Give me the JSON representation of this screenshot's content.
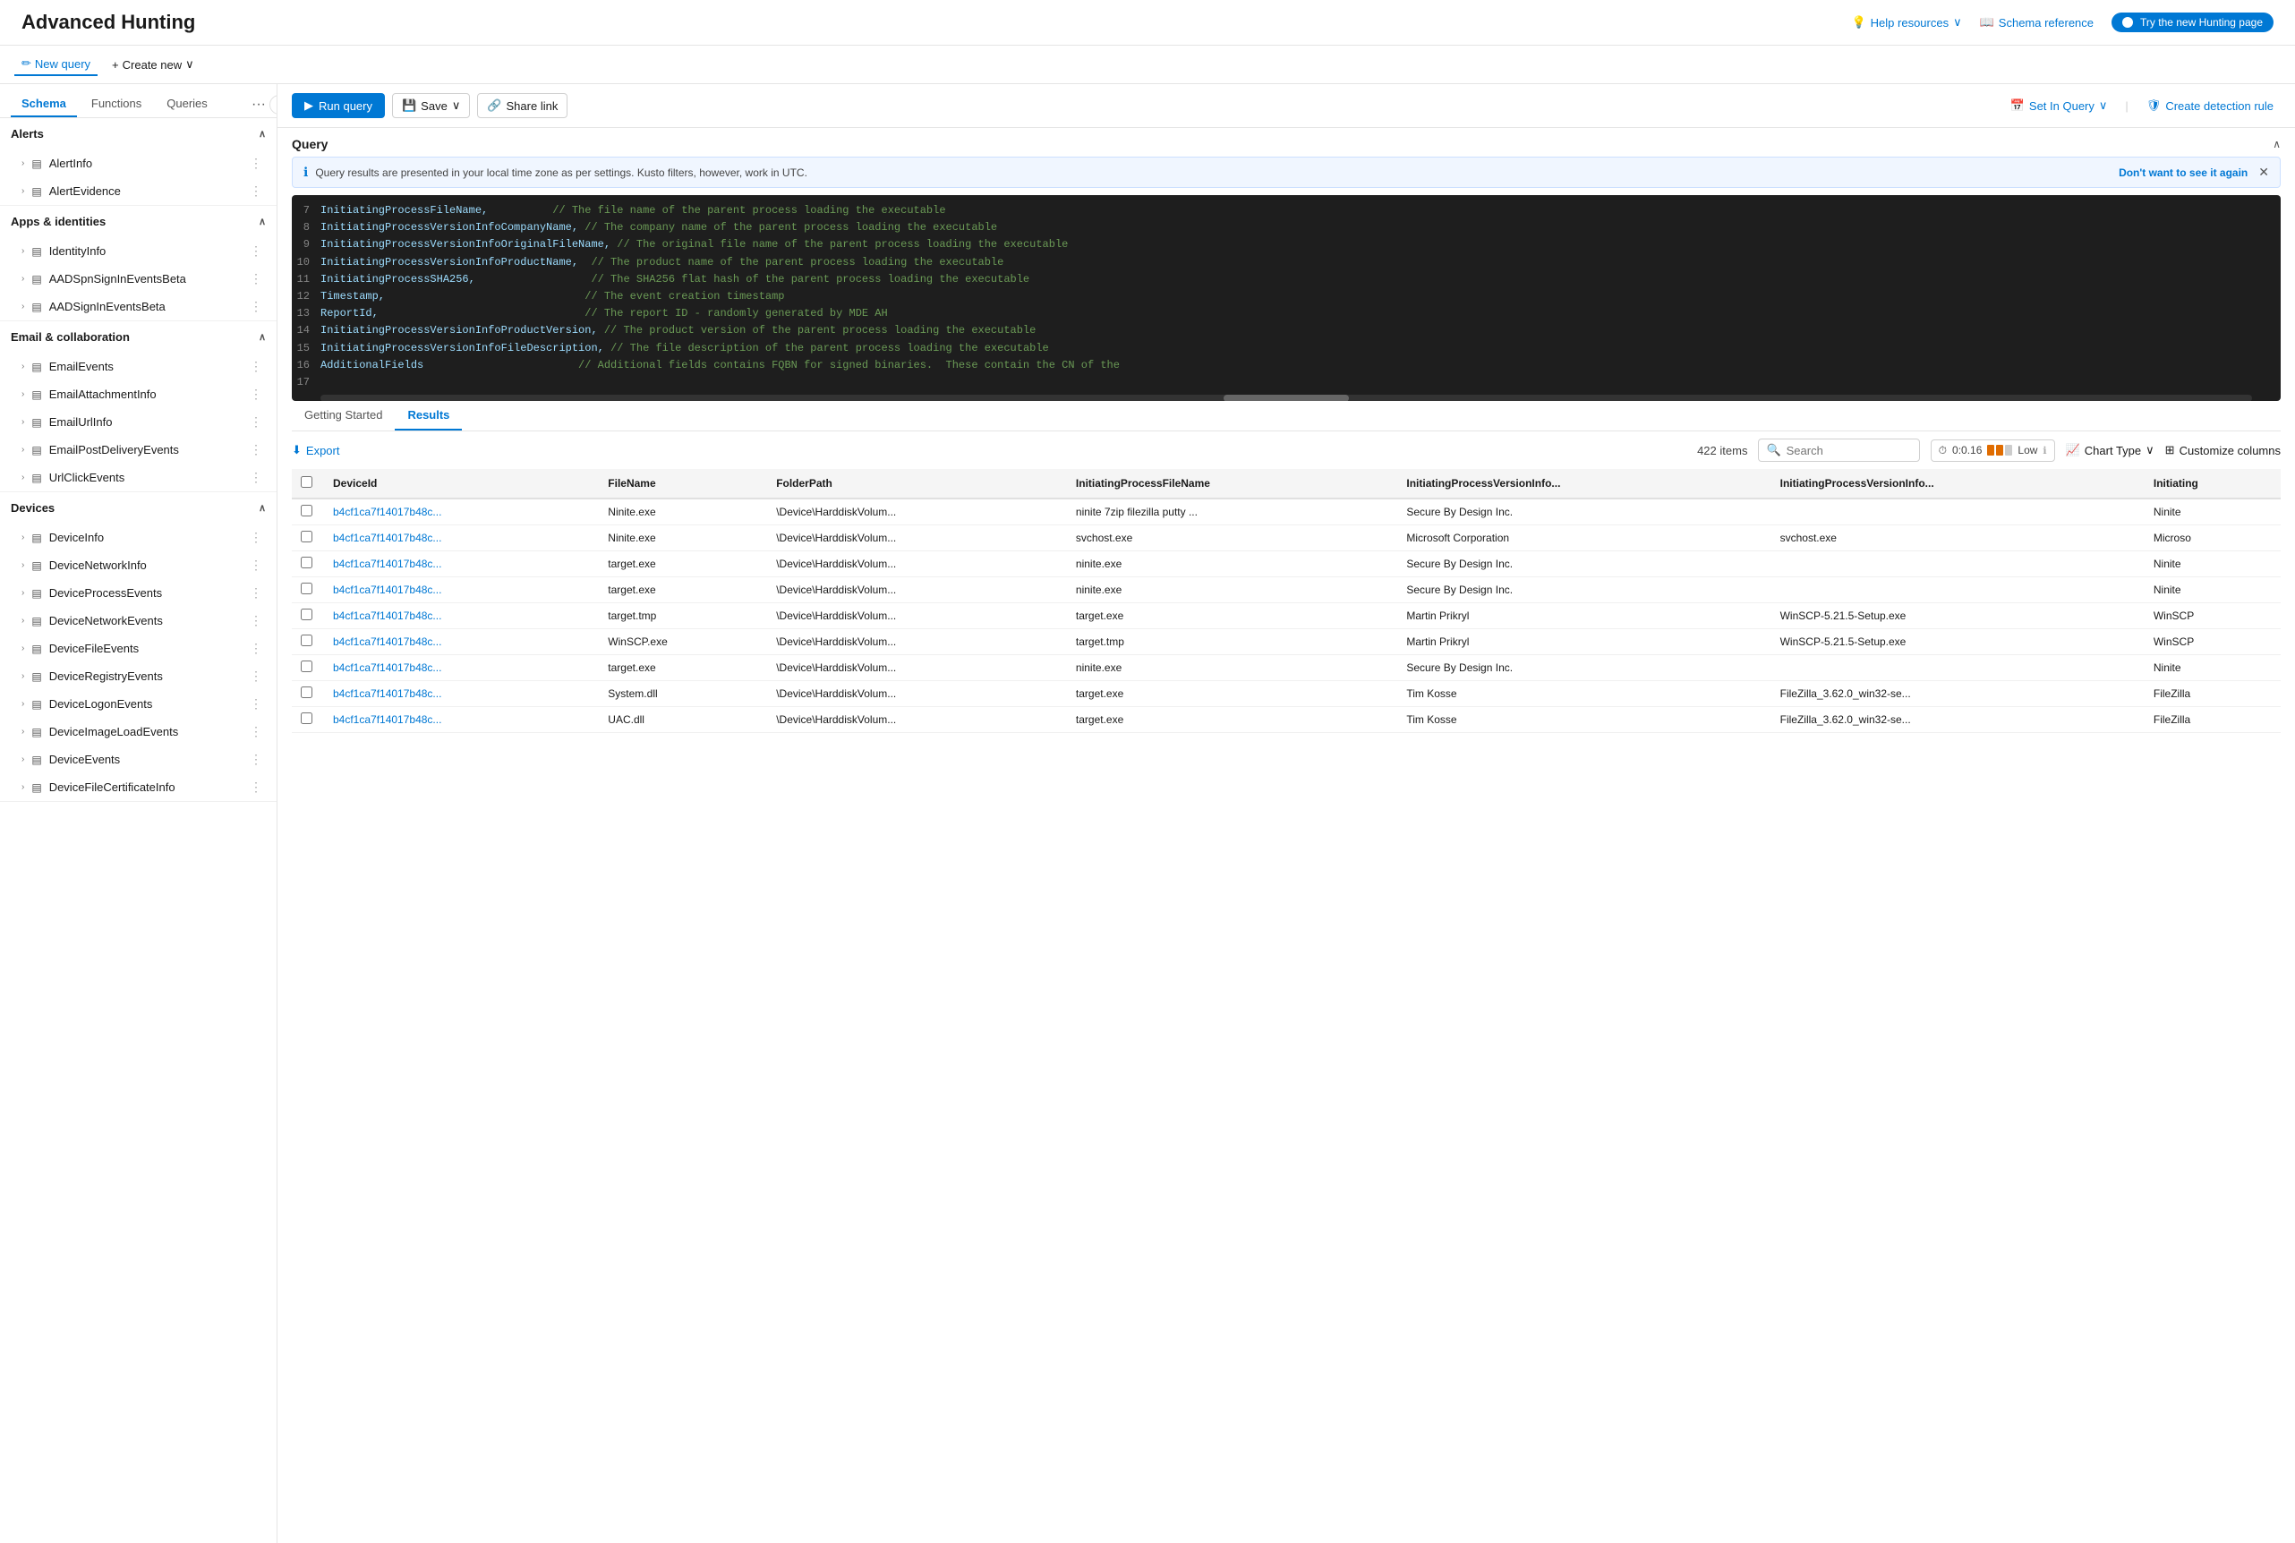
{
  "header": {
    "title": "Advanced Hunting",
    "help_resources": "Help resources",
    "schema_reference": "Schema reference",
    "try_new": "Try the new Hunting page"
  },
  "toolbar": {
    "new_query": "New query",
    "create_new": "Create new"
  },
  "sidebar": {
    "tabs": [
      {
        "label": "Schema",
        "active": true
      },
      {
        "label": "Functions"
      },
      {
        "label": "Queries"
      }
    ],
    "more_label": "...",
    "sections": [
      {
        "title": "Alerts",
        "expanded": true,
        "items": [
          {
            "label": "AlertInfo"
          },
          {
            "label": "AlertEvidence"
          }
        ]
      },
      {
        "title": "Apps & identities",
        "expanded": true,
        "items": [
          {
            "label": "IdentityInfo"
          },
          {
            "label": "AADSpnSignInEventsBeta"
          },
          {
            "label": "AADSignInEventsBeta"
          }
        ]
      },
      {
        "title": "Email & collaboration",
        "expanded": true,
        "items": [
          {
            "label": "EmailEvents"
          },
          {
            "label": "EmailAttachmentInfo"
          },
          {
            "label": "EmailUrlInfo"
          },
          {
            "label": "EmailPostDeliveryEvents"
          },
          {
            "label": "UrlClickEvents"
          }
        ]
      },
      {
        "title": "Devices",
        "expanded": true,
        "items": [
          {
            "label": "DeviceInfo"
          },
          {
            "label": "DeviceNetworkInfo"
          },
          {
            "label": "DeviceProcessEvents"
          },
          {
            "label": "DeviceNetworkEvents"
          },
          {
            "label": "DeviceFileEvents"
          },
          {
            "label": "DeviceRegistryEvents"
          },
          {
            "label": "DeviceLogonEvents"
          },
          {
            "label": "DeviceImageLoadEvents"
          },
          {
            "label": "DeviceEvents"
          },
          {
            "label": "DeviceFileCertificateInfo"
          }
        ]
      }
    ]
  },
  "query_toolbar": {
    "run_query": "Run query",
    "save": "Save",
    "share_link": "Share link",
    "set_in_query": "Set In Query",
    "create_detection": "Create detection rule"
  },
  "query": {
    "title": "Query",
    "info_banner": "Query results are presented in your local time zone as per settings. Kusto filters, however, work in UTC.",
    "dont_show": "Don't want to see it again",
    "lines": [
      {
        "num": "7",
        "content": "InitiatingProcessFileName,",
        "type": "field",
        "comment": "// The file name of the parent process loading the executable"
      },
      {
        "num": "8",
        "content": "InitiatingProcessVersionInfoCompanyName,",
        "type": "field",
        "comment": "// The company name of the parent process loading the executable"
      },
      {
        "num": "9",
        "content": "InitiatingProcessVersionInfoOriginalFileName,",
        "type": "field",
        "comment": "// The original file name of the parent process loading the executable"
      },
      {
        "num": "10",
        "content": "InitiatingProcessVersionInfoProductName,",
        "type": "field",
        "comment": "// The product name of the parent process loading the executable"
      },
      {
        "num": "11",
        "content": "InitiatingProcessSHA256,",
        "type": "field",
        "comment": "// The SHA256 flat hash of the parent process loading the executable"
      },
      {
        "num": "12",
        "content": "Timestamp,",
        "type": "field",
        "comment": "// The event creation timestamp"
      },
      {
        "num": "13",
        "content": "ReportId,",
        "type": "field",
        "comment": "// The report ID - randomly generated by MDE AH"
      },
      {
        "num": "14",
        "content": "InitiatingProcessVersionInfoProductVersion,",
        "type": "field",
        "comment": "// The product version of the parent process loading the executable"
      },
      {
        "num": "15",
        "content": "InitiatingProcessVersionInfoFileDescription,",
        "type": "field",
        "comment": "// The file description of the parent process loading the executable"
      },
      {
        "num": "16",
        "content": "AdditionalFields",
        "type": "field",
        "comment": "// Additional fields contains FQBN for signed binaries.  These contain the CN of the"
      },
      {
        "num": "17",
        "content": "",
        "type": "empty",
        "comment": ""
      }
    ]
  },
  "results": {
    "tabs": [
      {
        "label": "Getting Started",
        "active": false
      },
      {
        "label": "Results",
        "active": true
      }
    ],
    "export": "Export",
    "items_count": "422 items",
    "search_placeholder": "Search",
    "timing": "0:0.16",
    "timing_label": "Low",
    "chart_type": "Chart Type",
    "customize": "Customize columns",
    "columns": [
      "DeviceId",
      "FileName",
      "FolderPath",
      "InitiatingProcessFileName",
      "InitiatingProcessVersionInfo...",
      "InitiatingProcessVersionInfo...",
      "Initiating"
    ],
    "rows": [
      {
        "deviceId": "b4cf1ca7f14017b48c...",
        "fileName": "Ninite.exe",
        "folderPath": "\\Device\\HarddiskVolum...",
        "initiatingProcessFileName": "ninite 7zip filezilla putty ...",
        "col5": "Secure By Design Inc.",
        "col6": "",
        "col7": "Ninite"
      },
      {
        "deviceId": "b4cf1ca7f14017b48c...",
        "fileName": "Ninite.exe",
        "folderPath": "\\Device\\HarddiskVolum...",
        "initiatingProcessFileName": "svchost.exe",
        "col5": "Microsoft Corporation",
        "col6": "svchost.exe",
        "col7": "Microso"
      },
      {
        "deviceId": "b4cf1ca7f14017b48c...",
        "fileName": "target.exe",
        "folderPath": "\\Device\\HarddiskVolum...",
        "initiatingProcessFileName": "ninite.exe",
        "col5": "Secure By Design Inc.",
        "col6": "",
        "col7": "Ninite"
      },
      {
        "deviceId": "b4cf1ca7f14017b48c...",
        "fileName": "target.exe",
        "folderPath": "\\Device\\HarddiskVolum...",
        "initiatingProcessFileName": "ninite.exe",
        "col5": "Secure By Design Inc.",
        "col6": "",
        "col7": "Ninite"
      },
      {
        "deviceId": "b4cf1ca7f14017b48c...",
        "fileName": "target.tmp",
        "folderPath": "\\Device\\HarddiskVolum...",
        "initiatingProcessFileName": "target.exe",
        "col5": "Martin Prikryl",
        "col6": "WinSCP-5.21.5-Setup.exe",
        "col7": "WinSCP"
      },
      {
        "deviceId": "b4cf1ca7f14017b48c...",
        "fileName": "WinSCP.exe",
        "folderPath": "\\Device\\HarddiskVolum...",
        "initiatingProcessFileName": "target.tmp",
        "col5": "Martin Prikryl",
        "col6": "WinSCP-5.21.5-Setup.exe",
        "col7": "WinSCP"
      },
      {
        "deviceId": "b4cf1ca7f14017b48c...",
        "fileName": "target.exe",
        "folderPath": "\\Device\\HarddiskVolum...",
        "initiatingProcessFileName": "ninite.exe",
        "col5": "Secure By Design Inc.",
        "col6": "",
        "col7": "Ninite"
      },
      {
        "deviceId": "b4cf1ca7f14017b48c...",
        "fileName": "System.dll",
        "folderPath": "\\Device\\HarddiskVolum...",
        "initiatingProcessFileName": "target.exe",
        "col5": "Tim Kosse",
        "col6": "FileZilla_3.62.0_win32-se...",
        "col7": "FileZilla"
      },
      {
        "deviceId": "b4cf1ca7f14017b48c...",
        "fileName": "UAC.dll",
        "folderPath": "\\Device\\HarddiskVolum...",
        "initiatingProcessFileName": "target.exe",
        "col5": "Tim Kosse",
        "col6": "FileZilla_3.62.0_win32-se...",
        "col7": "FileZilla"
      }
    ]
  }
}
